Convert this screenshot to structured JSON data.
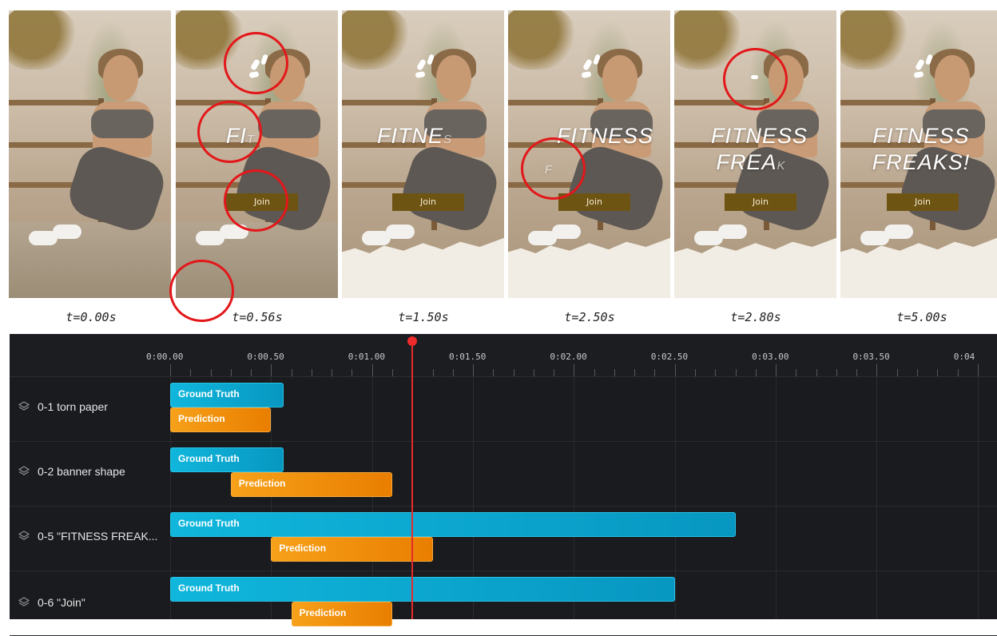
{
  "frames": [
    {
      "time_label": "t=0.00s",
      "title": "",
      "title_faint": "",
      "title2": "",
      "title2_faint": "",
      "join": ""
    },
    {
      "time_label": "t=0.56s",
      "title": "FI",
      "title_faint": "T",
      "title2": "",
      "title2_faint": "",
      "join": "Join"
    },
    {
      "time_label": "t=1.50s",
      "title": "FITNE",
      "title_faint": "S",
      "title2": "",
      "title2_faint": "",
      "join": "Join"
    },
    {
      "time_label": "t=2.50s",
      "title": "FITNESS",
      "title_faint": "",
      "title2": "",
      "title2_faint": "F",
      "join": "Join"
    },
    {
      "time_label": "t=2.80s",
      "title": "FITNESS",
      "title_faint": "",
      "title2": "FREA",
      "title2_faint": "K",
      "join": "Join"
    },
    {
      "time_label": "t=5.00s",
      "title": "FITNESS",
      "title_faint": "",
      "title2": "FREAKS!",
      "title2_faint": "",
      "join": "Join"
    }
  ],
  "timeline": {
    "ticks": [
      "0:00.00",
      "0:00.50",
      "0:01.00",
      "0:01.50",
      "0:02.00",
      "0:02.50",
      "0:03.00",
      "0:03.50",
      "0:04"
    ],
    "playhead_time": 1.2,
    "rows": [
      {
        "label": "0-1 torn paper",
        "gt": {
          "label": "Ground Truth",
          "start": 0.0,
          "end": 0.56
        },
        "pred": {
          "label": "Prediction",
          "start": 0.0,
          "end": 0.5
        }
      },
      {
        "label": "0-2 banner shape",
        "gt": {
          "label": "Ground Truth",
          "start": 0.0,
          "end": 0.56
        },
        "pred": {
          "label": "Prediction",
          "start": 0.3,
          "end": 1.1
        }
      },
      {
        "label": "0-5 \"FITNESS FREAK...",
        "gt": {
          "label": "Ground Truth",
          "start": 0.0,
          "end": 2.8
        },
        "pred": {
          "label": "Prediction",
          "start": 0.5,
          "end": 1.3
        }
      },
      {
        "label": "0-6 \"Join\"",
        "gt": {
          "label": "Ground Truth",
          "start": 0.0,
          "end": 2.5
        },
        "pred": {
          "label": "Prediction",
          "start": 0.6,
          "end": 1.1
        }
      }
    ],
    "colors": {
      "ground_truth": "#0aa8d2",
      "prediction": "#f08c0a",
      "playhead": "#e52b2b",
      "panel_bg": "#1a1b1e"
    }
  }
}
